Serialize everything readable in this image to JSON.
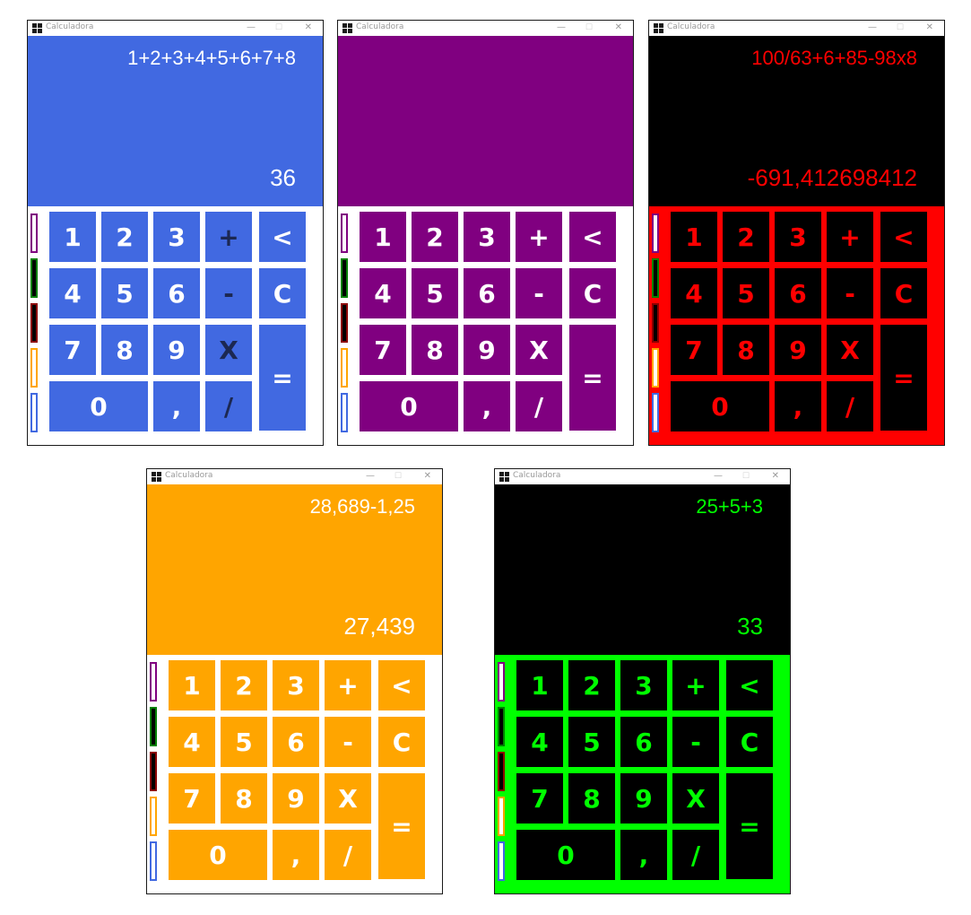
{
  "windows": [
    {
      "theme": "blue",
      "title": "Calculadora",
      "expression": "1+2+3+4+5+6+7+8",
      "result": "36"
    },
    {
      "theme": "purple",
      "title": "Calculadora",
      "expression": "",
      "result": ""
    },
    {
      "theme": "red",
      "title": "Calculadora",
      "expression": "100/63+6+85-98x8",
      "result": "-691,412698412"
    },
    {
      "theme": "orange",
      "title": "Calculadora",
      "expression": "28,689-1,25",
      "result": "27,439"
    },
    {
      "theme": "green",
      "title": "Calculadora",
      "expression": "25+5+3",
      "result": "33"
    }
  ],
  "titlebar": {
    "minimize": "—",
    "maximize": "☐",
    "close": "✕"
  },
  "keys": {
    "one": "1",
    "two": "2",
    "three": "3",
    "plus": "+",
    "backspace": "<",
    "four": "4",
    "five": "5",
    "six": "6",
    "minus": "-",
    "clear": "C",
    "seven": "7",
    "eight": "8",
    "nine": "9",
    "multiply": "X",
    "equals": "=",
    "zero": "0",
    "comma": ",",
    "divide": "/"
  },
  "theme_colors": {
    "purple": "#800080",
    "green": "#008000",
    "dark_red": "#8b0000",
    "orange": "#ffa500",
    "blue": "#4169e1"
  }
}
